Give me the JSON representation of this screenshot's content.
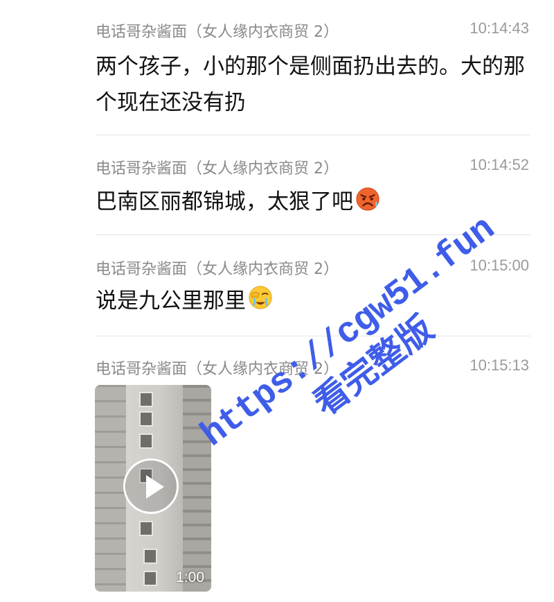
{
  "messages": [
    {
      "sender": "电话哥杂酱面（女人缘内衣商贸 2）",
      "time": "10:14:43",
      "text": "两个孩子，小的那个是侧面扔出去的。大的那个现在还没有扔",
      "emoji": ""
    },
    {
      "sender": "电话哥杂酱面（女人缘内衣商贸 2）",
      "time": "10:14:52",
      "text": "巴南区丽都锦城，太狠了吧",
      "emoji": "angry-sweat-face-icon"
    },
    {
      "sender": "电话哥杂酱面（女人缘内衣商贸 2）",
      "time": "10:15:00",
      "text": "说是九公里那里",
      "emoji": "facepalm-face-icon"
    },
    {
      "sender": "电话哥杂酱面（女人缘内衣商贸 2）",
      "time": "10:15:13",
      "video": {
        "duration": "1:00",
        "icon": "play-icon"
      }
    }
  ],
  "watermark": {
    "url": "https://cgw51.fun",
    "cta": "看完整版",
    "color": "#3f5de8"
  },
  "colors": {
    "sender": "#8a8a8a",
    "time": "#9a9a9a",
    "text": "#111111",
    "divider": "#e4e4e4"
  }
}
